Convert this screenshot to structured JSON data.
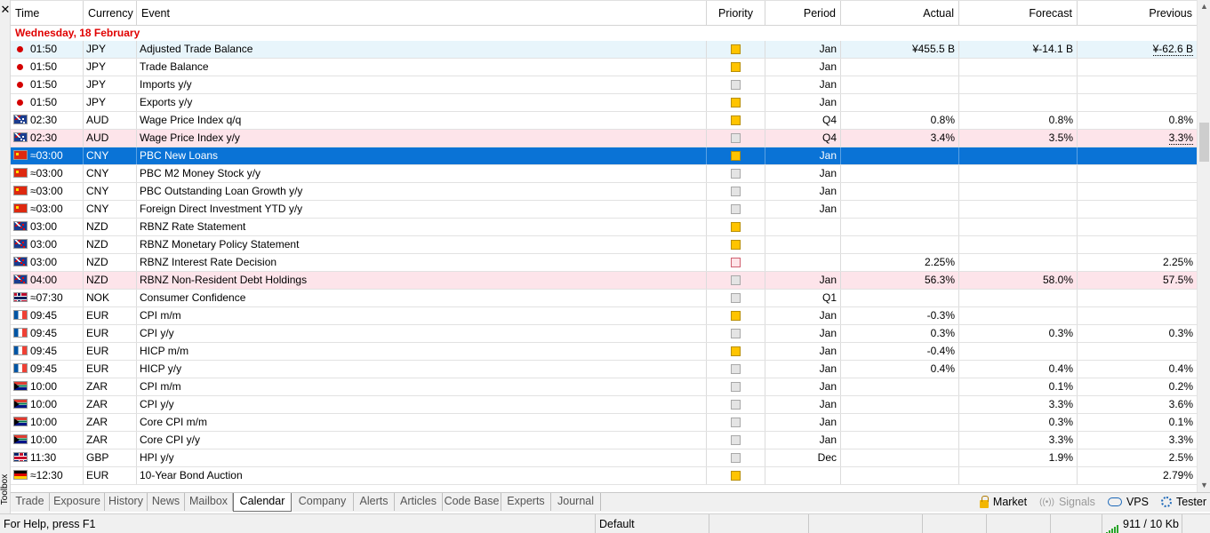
{
  "toolbox": {
    "close_glyph": "✕",
    "label": "Toolbox"
  },
  "columns": {
    "time": "Time",
    "currency": "Currency",
    "event": "Event",
    "priority": "Priority",
    "period": "Period",
    "actual": "Actual",
    "forecast": "Forecast",
    "previous": "Previous"
  },
  "day_header": "Wednesday, 18 February",
  "rows": [
    {
      "time": "01:50",
      "marker": "dot",
      "currency": "JPY",
      "event": "Adjusted Trade Balance",
      "priority": "yellow",
      "period": "Jan",
      "actual": "¥455.5 B",
      "forecast": "¥-14.1 B",
      "previous": "¥-62.6 B",
      "prev_dashed": true,
      "style": "alt-blue"
    },
    {
      "time": "01:50",
      "marker": "dot",
      "currency": "JPY",
      "event": "Trade Balance",
      "priority": "yellow",
      "period": "Jan",
      "actual": "",
      "forecast": "",
      "previous": "",
      "style": ""
    },
    {
      "time": "01:50",
      "marker": "dot",
      "currency": "JPY",
      "event": "Imports y/y",
      "priority": "gray",
      "period": "Jan",
      "actual": "",
      "forecast": "",
      "previous": "",
      "style": ""
    },
    {
      "time": "01:50",
      "marker": "dot",
      "currency": "JPY",
      "event": "Exports y/y",
      "priority": "yellow",
      "period": "Jan",
      "actual": "",
      "forecast": "",
      "previous": "",
      "style": ""
    },
    {
      "time": "02:30",
      "marker": "aud",
      "currency": "AUD",
      "event": "Wage Price Index q/q",
      "priority": "yellow",
      "period": "Q4",
      "actual": "0.8%",
      "forecast": "0.8%",
      "previous": "0.8%",
      "style": ""
    },
    {
      "time": "02:30",
      "marker": "aud",
      "currency": "AUD",
      "event": "Wage Price Index y/y",
      "priority": "gray",
      "period": "Q4",
      "actual": "3.4%",
      "forecast": "3.5%",
      "previous": "3.3%",
      "prev_dashed": true,
      "style": "alt-pink"
    },
    {
      "time": "≈03:00",
      "marker": "cny",
      "currency": "CNY",
      "event": "PBC New Loans",
      "priority": "yellow",
      "period": "Jan",
      "actual": "",
      "forecast": "",
      "previous": "",
      "style": "sel"
    },
    {
      "time": "≈03:00",
      "marker": "cny",
      "currency": "CNY",
      "event": "PBC M2 Money Stock y/y",
      "priority": "gray",
      "period": "Jan",
      "actual": "",
      "forecast": "",
      "previous": "",
      "style": ""
    },
    {
      "time": "≈03:00",
      "marker": "cny",
      "currency": "CNY",
      "event": "PBC Outstanding Loan Growth y/y",
      "priority": "gray",
      "period": "Jan",
      "actual": "",
      "forecast": "",
      "previous": "",
      "style": ""
    },
    {
      "time": "≈03:00",
      "marker": "cny",
      "currency": "CNY",
      "event": "Foreign Direct Investment YTD y/y",
      "priority": "gray",
      "period": "Jan",
      "actual": "",
      "forecast": "",
      "previous": "",
      "style": ""
    },
    {
      "time": "03:00",
      "marker": "nzd",
      "currency": "NZD",
      "event": "RBNZ Rate Statement",
      "priority": "yellow",
      "period": "",
      "actual": "",
      "forecast": "",
      "previous": "",
      "style": ""
    },
    {
      "time": "03:00",
      "marker": "nzd",
      "currency": "NZD",
      "event": "RBNZ Monetary Policy Statement",
      "priority": "yellow",
      "period": "",
      "actual": "",
      "forecast": "",
      "previous": "",
      "style": ""
    },
    {
      "time": "03:00",
      "marker": "nzd",
      "currency": "NZD",
      "event": "RBNZ Interest Rate Decision",
      "priority": "pink",
      "period": "",
      "actual": "2.25%",
      "forecast": "",
      "previous": "2.25%",
      "style": ""
    },
    {
      "time": "04:00",
      "marker": "nzd",
      "currency": "NZD",
      "event": "RBNZ Non-Resident Debt Holdings",
      "priority": "gray",
      "period": "Jan",
      "actual": "56.3%",
      "forecast": "58.0%",
      "previous": "57.5%",
      "style": "alt-pink"
    },
    {
      "time": "≈07:30",
      "marker": "nok",
      "currency": "NOK",
      "event": "Consumer Confidence",
      "priority": "gray",
      "period": "Q1",
      "actual": "",
      "forecast": "",
      "previous": "",
      "style": ""
    },
    {
      "time": "09:45",
      "marker": "eur",
      "currency": "EUR",
      "event": "CPI m/m",
      "priority": "yellow",
      "period": "Jan",
      "actual": "-0.3%",
      "forecast": "",
      "previous": "",
      "style": ""
    },
    {
      "time": "09:45",
      "marker": "eur",
      "currency": "EUR",
      "event": "CPI y/y",
      "priority": "gray",
      "period": "Jan",
      "actual": "0.3%",
      "forecast": "0.3%",
      "previous": "0.3%",
      "style": ""
    },
    {
      "time": "09:45",
      "marker": "eur",
      "currency": "EUR",
      "event": "HICP m/m",
      "priority": "yellow",
      "period": "Jan",
      "actual": "-0.4%",
      "forecast": "",
      "previous": "",
      "style": ""
    },
    {
      "time": "09:45",
      "marker": "eur",
      "currency": "EUR",
      "event": "HICP y/y",
      "priority": "gray",
      "period": "Jan",
      "actual": "0.4%",
      "forecast": "0.4%",
      "previous": "0.4%",
      "style": ""
    },
    {
      "time": "10:00",
      "marker": "zar",
      "currency": "ZAR",
      "event": "CPI m/m",
      "priority": "gray",
      "period": "Jan",
      "actual": "",
      "forecast": "0.1%",
      "previous": "0.2%",
      "style": ""
    },
    {
      "time": "10:00",
      "marker": "zar",
      "currency": "ZAR",
      "event": "CPI y/y",
      "priority": "gray",
      "period": "Jan",
      "actual": "",
      "forecast": "3.3%",
      "previous": "3.6%",
      "style": ""
    },
    {
      "time": "10:00",
      "marker": "zar",
      "currency": "ZAR",
      "event": "Core CPI m/m",
      "priority": "gray",
      "period": "Jan",
      "actual": "",
      "forecast": "0.3%",
      "previous": "0.1%",
      "style": ""
    },
    {
      "time": "10:00",
      "marker": "zar",
      "currency": "ZAR",
      "event": "Core CPI y/y",
      "priority": "gray",
      "period": "Jan",
      "actual": "",
      "forecast": "3.3%",
      "previous": "3.3%",
      "style": ""
    },
    {
      "time": "11:30",
      "marker": "gbp",
      "currency": "GBP",
      "event": "HPI y/y",
      "priority": "gray",
      "period": "Dec",
      "actual": "",
      "forecast": "1.9%",
      "previous": "2.5%",
      "style": ""
    },
    {
      "time": "≈12:30",
      "marker": "deu",
      "currency": "EUR",
      "event": "10-Year Bond Auction",
      "priority": "yellow",
      "period": "",
      "actual": "",
      "forecast": "",
      "previous": "2.79%",
      "style": ""
    }
  ],
  "tabs": [
    "Trade",
    "Exposure",
    "History",
    "News",
    "Mailbox",
    "Calendar",
    "Company",
    "Alerts",
    "Articles",
    "Code Base",
    "Experts",
    "Journal"
  ],
  "active_tab": "Calendar",
  "right_tools": {
    "market": "Market",
    "signals": "Signals",
    "vps": "VPS",
    "tester": "Tester"
  },
  "status": {
    "help": "For Help, press F1",
    "profile": "Default",
    "traffic": "911 / 10 Kb"
  },
  "colors": {
    "day_header": "#e00000",
    "selection": "#0a73d6",
    "row_blue": "#e8f5fb",
    "row_pink": "#fde4ea",
    "priority_high": "#ffc400",
    "priority_low": "#e4e4e4",
    "signal_bars": "#2aa52a"
  }
}
